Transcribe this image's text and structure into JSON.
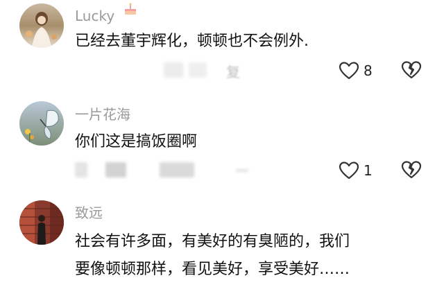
{
  "comments": [
    {
      "username": "Lucky",
      "username_icon": "cake-icon",
      "text": "已经去董宇辉化，顿顿也不会例外.",
      "like_count": "8",
      "reply_label": "复"
    },
    {
      "username": "一片花海",
      "text": "你们这是搞饭圈啊",
      "like_count": "1"
    },
    {
      "username": "致远",
      "text_lines": [
        "社会有许多面，有美好的有臭陋的，我们",
        "要像顿顿那样，看见美好，享受美好……"
      ]
    }
  ],
  "icons": {
    "like": "heart-outline-icon",
    "dislike": "broken-heart-icon"
  },
  "colors": {
    "username": "#9a9a9a",
    "text": "#111111",
    "icon_stroke": "#333333",
    "blur_placeholder": "#e4e4e4"
  }
}
